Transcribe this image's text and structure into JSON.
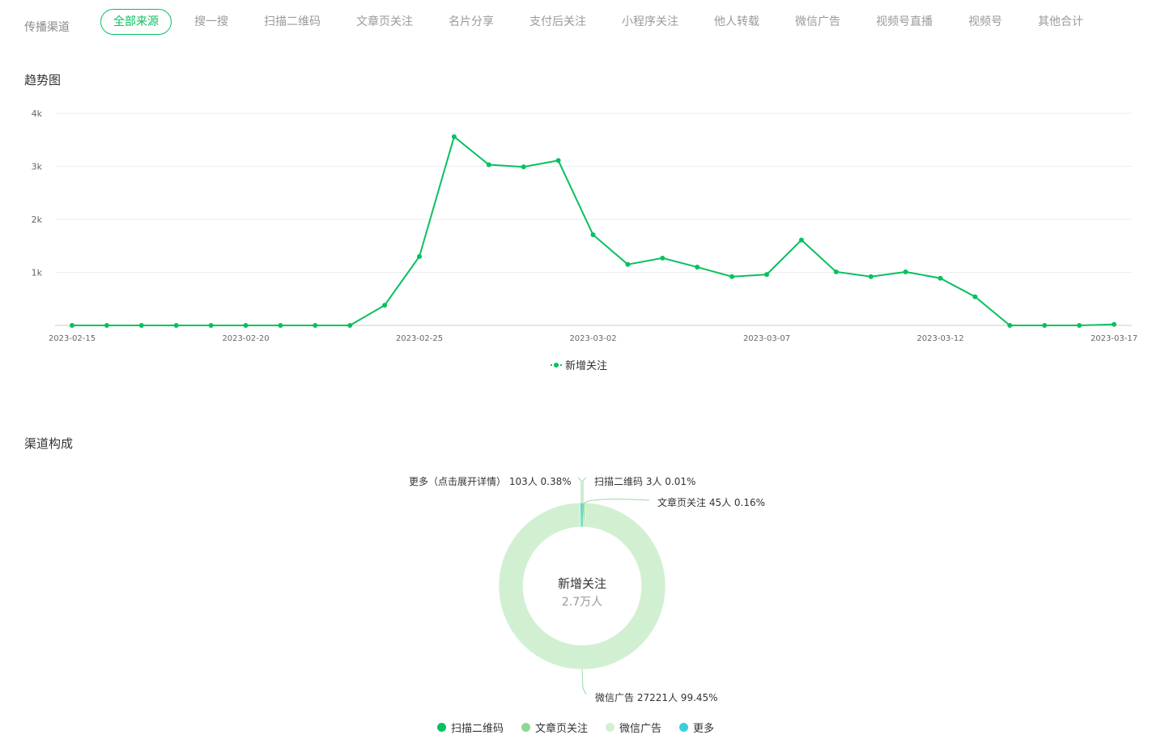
{
  "channel_bar": {
    "label": "传播渠道",
    "tabs": [
      {
        "label": "全部来源",
        "active": true
      },
      {
        "label": "搜一搜"
      },
      {
        "label": "扫描二维码"
      },
      {
        "label": "文章页关注"
      },
      {
        "label": "名片分享"
      },
      {
        "label": "支付后关注"
      },
      {
        "label": "小程序关注"
      },
      {
        "label": "他人转载"
      },
      {
        "label": "微信广告"
      },
      {
        "label": "视频号直播"
      },
      {
        "label": "视频号"
      },
      {
        "label": "其他合计"
      }
    ]
  },
  "trend": {
    "title": "趋势图"
  },
  "composition": {
    "title": "渠道构成",
    "center_title": "新增关注",
    "center_value": "2.7万人",
    "labels": {
      "more": "更多（点击展开详情） 103人 0.38%",
      "qr": "扫描二维码 3人 0.01%",
      "article": "文章页关注 45人 0.16%",
      "ads": "微信广告 27221人 99.45%"
    }
  },
  "colors": {
    "accent": "#07c160",
    "qr": "#07c160",
    "article": "#8fd891",
    "ads": "#d1f0d2",
    "more": "#3bcde0",
    "grid": "#eeeeee",
    "axis": "#cccccc"
  },
  "chart_data": [
    {
      "type": "line",
      "x": [
        "2023-02-15",
        "2023-02-16",
        "2023-02-17",
        "2023-02-18",
        "2023-02-19",
        "2023-02-20",
        "2023-02-21",
        "2023-02-22",
        "2023-02-23",
        "2023-02-24",
        "2023-02-25",
        "2023-02-26",
        "2023-02-27",
        "2023-02-28",
        "2023-03-01",
        "2023-03-02",
        "2023-03-03",
        "2023-03-04",
        "2023-03-05",
        "2023-03-06",
        "2023-03-07",
        "2023-03-08",
        "2023-03-09",
        "2023-03-10",
        "2023-03-11",
        "2023-03-12",
        "2023-03-13",
        "2023-03-14",
        "2023-03-15",
        "2023-03-16",
        "2023-03-17"
      ],
      "x_tick_labels": [
        "2023-02-15",
        "2023-02-20",
        "2023-02-25",
        "2023-03-02",
        "2023-03-07",
        "2023-03-12",
        "2023-03-17"
      ],
      "series": [
        {
          "name": "新增关注",
          "values": [
            0,
            0,
            0,
            0,
            0,
            0,
            0,
            0,
            0,
            380,
            1300,
            3560,
            3030,
            2990,
            3110,
            1710,
            1150,
            1270,
            1100,
            920,
            960,
            1610,
            1010,
            920,
            1010,
            890,
            540,
            0,
            0,
            0,
            20
          ]
        }
      ],
      "y_ticks": [
        "4k",
        "3k",
        "2k",
        "1k"
      ],
      "ylim": [
        0,
        4000
      ],
      "grid": true,
      "legend": "bottom-center"
    },
    {
      "type": "pie",
      "variant": "donut",
      "categories": [
        "扫描二维码",
        "文章页关注",
        "微信广告",
        "更多"
      ],
      "values": [
        3,
        45,
        27221,
        103
      ],
      "percentages": [
        0.01,
        0.16,
        99.45,
        0.38
      ],
      "legend": "bottom-center"
    }
  ]
}
